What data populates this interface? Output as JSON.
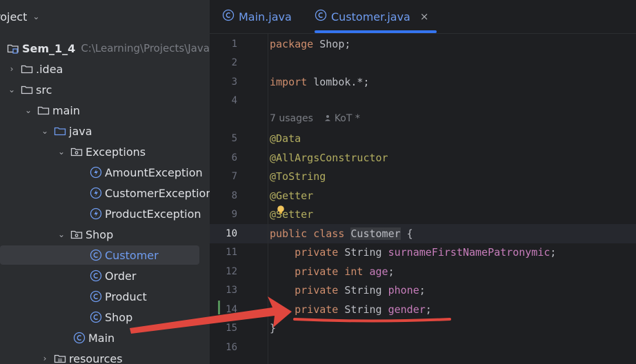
{
  "project": {
    "header_label": "roject",
    "tree": [
      {
        "label": "Sem_1_4",
        "hint": "C:\\Learning\\Projects\\Java",
        "icon": "module-folder-icon"
      },
      {
        "label": ".idea",
        "icon": "folder-icon"
      },
      {
        "label": "src",
        "icon": "folder-icon"
      },
      {
        "label": "main",
        "icon": "folder-icon"
      },
      {
        "label": "java",
        "icon": "source-folder-icon"
      },
      {
        "label": "Exceptions",
        "icon": "package-icon"
      },
      {
        "label": "AmountException",
        "icon": "exception-class-icon"
      },
      {
        "label": "CustomerException",
        "icon": "exception-class-icon"
      },
      {
        "label": "ProductException",
        "icon": "exception-class-icon"
      },
      {
        "label": "Shop",
        "icon": "package-icon"
      },
      {
        "label": "Customer",
        "icon": "class-icon"
      },
      {
        "label": "Order",
        "icon": "class-icon"
      },
      {
        "label": "Product",
        "icon": "class-icon"
      },
      {
        "label": "Shop",
        "icon": "class-icon"
      },
      {
        "label": "Main",
        "icon": "class-icon"
      },
      {
        "label": "resources",
        "icon": "resources-folder-icon"
      }
    ]
  },
  "tabs": [
    {
      "label": "Main.java"
    },
    {
      "label": "Customer.java",
      "close": "×"
    }
  ],
  "editor": {
    "line_numbers": [
      "1",
      "2",
      "3",
      "4",
      "5",
      "6",
      "7",
      "8",
      "9",
      "10",
      "11",
      "12",
      "13",
      "14",
      "15",
      "16"
    ],
    "hint_usages": "7 usages",
    "hint_author": "KoT *",
    "code": {
      "l1_kw": "package",
      "l1_rest": " Shop;",
      "l3_kw": "import",
      "l3_rest": " lombok.*;",
      "l5": "@Data",
      "l6": "@AllArgsConstructor",
      "l7": "@ToString",
      "l8": "@Getter",
      "l9": "@Setter",
      "l10_kw": "public class",
      "l10_cls": "Customer",
      "l10_rest": " {",
      "private_kw": "private",
      "int_kw": "int",
      "string_type": " String ",
      "f1": "surnameFirstNamePatronymic",
      "f2": "age",
      "f3": "phone",
      "f4": "gender",
      "semi": ";",
      "l15": "}"
    }
  },
  "colors": {
    "accent": "#3574f0",
    "annotation_arrow": "#e0473e",
    "keyword": "#cf8e6d",
    "annotation": "#b3ae60",
    "field": "#c77dbb"
  }
}
